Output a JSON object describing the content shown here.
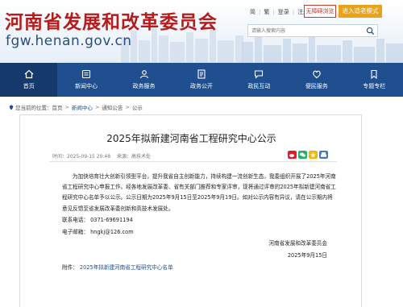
{
  "header": {
    "site_title": "河南省发展和改革委员会",
    "site_domain": "fgw.henan.gov.cn",
    "top_links": [
      "简",
      "繁",
      "登录",
      "注册"
    ],
    "barrier_free": "无障碍浏览",
    "elder_mode": "进入适老模式",
    "search_placeholder": "请输入搜索内容"
  },
  "nav": {
    "items": [
      {
        "label": "首页",
        "icon": "home-icon",
        "active": true
      },
      {
        "label": "新闻中心",
        "icon": "news-icon",
        "active": false
      },
      {
        "label": "政务服务",
        "icon": "service-icon",
        "active": false
      },
      {
        "label": "政务公开",
        "icon": "open-gov-icon",
        "active": false
      },
      {
        "label": "政民互动",
        "icon": "interaction-icon",
        "active": false
      },
      {
        "label": "便民服务",
        "icon": "convenience-icon",
        "active": false
      },
      {
        "label": "专题专栏",
        "icon": "topic-icon",
        "active": false
      }
    ]
  },
  "breadcrumb": {
    "prefix": "您当前的位置：",
    "items": [
      "首页",
      "新闻中心",
      "通知公告",
      "公示"
    ]
  },
  "article": {
    "title": "2025年拟新建河南省工程研究中心公示",
    "time": "时间：2025-09-15 20:48",
    "source": "来源：高技术处",
    "body": "为加快培育壮大创新引领型平台，提升我省自主创新能力，持续构建一流创新生态，我委组织开展了2025年河南省工程研究中心申报工作。经各地发展改革委、省有关部门推荐和专家评审，现将通过评审的2025年拟新建河南省工程研究中心名单予以公示。公示日期为2025年9月15日至2025年9月19日。如对公示内容有异议，请在公示期内将意见反馈至省发展改革委创新和高技术发展处。",
    "contact_phone": "联系电话：  0371-69691194",
    "contact_email": "电子邮箱：  hngkj@126.com",
    "signature_org": "河南省发展和改革委员会",
    "signature_date": "2025年9月15日",
    "attachment_label": "附件：",
    "attachment_link": "2025年拟新建河南省工程研究中心名单"
  },
  "colors": {
    "brand_red": "#b71c1c",
    "nav_blue": "#1f4f8f",
    "elder_orange": "#e8a31b"
  }
}
